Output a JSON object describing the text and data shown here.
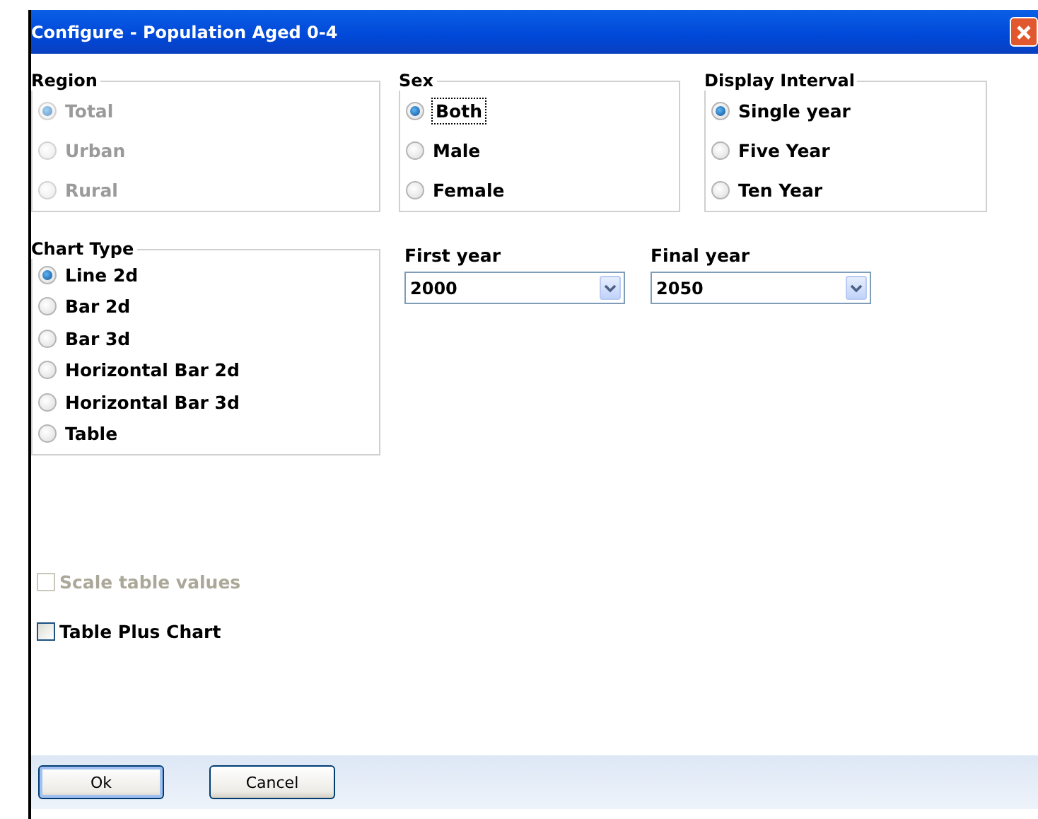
{
  "window": {
    "title": "Configure - Population Aged 0-4"
  },
  "groups": [
    {
      "title": "Region",
      "disabled": true,
      "options": [
        {
          "label": "Total",
          "selected": true,
          "focused": false
        },
        {
          "label": "Urban",
          "selected": false,
          "focused": false
        },
        {
          "label": "Rural",
          "selected": false,
          "focused": false
        }
      ]
    },
    {
      "title": "Sex",
      "disabled": false,
      "options": [
        {
          "label": "Both",
          "selected": true,
          "focused": true
        },
        {
          "label": "Male",
          "selected": false,
          "focused": false
        },
        {
          "label": "Female",
          "selected": false,
          "focused": false
        }
      ]
    },
    {
      "title": "Display Interval",
      "disabled": false,
      "options": [
        {
          "label": "Single year",
          "selected": true,
          "focused": false
        },
        {
          "label": "Five Year",
          "selected": false,
          "focused": false
        },
        {
          "label": "Ten Year",
          "selected": false,
          "focused": false
        }
      ]
    }
  ],
  "chart_type": {
    "title": "Chart Type",
    "options": [
      {
        "label": "Line 2d",
        "selected": true
      },
      {
        "label": "Bar 2d",
        "selected": false
      },
      {
        "label": "Bar 3d",
        "selected": false
      },
      {
        "label": "Horizontal Bar 2d",
        "selected": false
      },
      {
        "label": "Horizontal Bar 3d",
        "selected": false
      },
      {
        "label": "Table",
        "selected": false
      }
    ]
  },
  "dropdowns": [
    {
      "label": "First year",
      "value": "2000"
    },
    {
      "label": "Final year",
      "value": "2050"
    }
  ],
  "checkboxes": [
    {
      "label": "Scale table values",
      "checked": false,
      "disabled": true
    },
    {
      "label": "Table Plus Chart",
      "checked": false,
      "disabled": false
    }
  ],
  "buttons": [
    {
      "label": "Ok",
      "default": true
    },
    {
      "label": "Cancel",
      "default": false
    }
  ]
}
